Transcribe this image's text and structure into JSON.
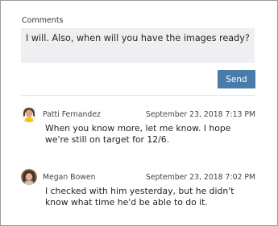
{
  "comments": {
    "label": "Comments",
    "input_value": "I will. Also, when will you have the images ready?",
    "send_label": "Send"
  },
  "thread": [
    {
      "author": "Patti Fernandez",
      "timestamp": "September 23, 2018 7:13 PM",
      "text": "When you know more, let me know. I hope we're still on target for 12/6.",
      "avatar_icon": "user-avatar-patti"
    },
    {
      "author": "Megan Bowen",
      "timestamp": "September 23, 2018 7:02 PM",
      "text": "I checked with him yesterday, but he didn't know what time he'd be able to do it.",
      "avatar_icon": "user-avatar-megan"
    }
  ],
  "colors": {
    "send_button": "#4a7cab",
    "input_background": "#efeff2"
  }
}
